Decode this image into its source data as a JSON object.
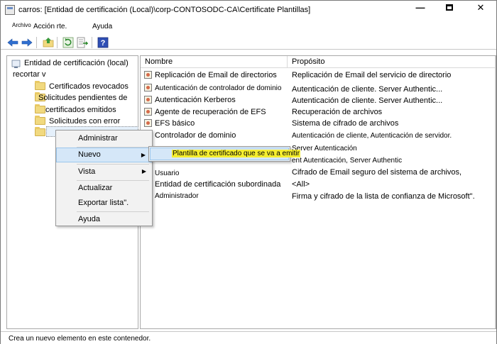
{
  "window": {
    "title": "carros: [Entidad de certificación       (Local)\\corp-CONTOSODC-CA\\Certificate Plantillas]",
    "controls": {
      "minimize": "—",
      "close": "✕"
    }
  },
  "menubar": {
    "items": [
      {
        "label": "Archivo"
      },
      {
        "label": "Acción rte."
      },
      {
        "label": "Ayuda"
      }
    ]
  },
  "toolbar": {
    "icons": [
      "back-arrow-icon",
      "forward-arrow-icon",
      "up-folder-icon",
      "refresh-icon",
      "export-list-icon",
      "help-icon"
    ],
    "help_glyph": "?"
  },
  "tree": {
    "root_line1": "Entidad de certificación (local)",
    "root_line2": "recortar v",
    "items": [
      {
        "label": "Certificados revocados"
      },
      {
        "label": "Solicitudes pendientes de"
      },
      {
        "label": "certificados emitidos"
      },
      {
        "label": "Solicitudes con error"
      }
    ]
  },
  "list": {
    "columns": [
      "Nombre",
      "Propósito"
    ],
    "rows": [
      {
        "name": "Replicación de Email de directorios",
        "purpose": "Replicación de Email del servicio de directorio"
      },
      {
        "name": "Autenticación de controlador de dominio",
        "purpose": "Autenticación de cliente. Server Authentic..."
      },
      {
        "name": "Autenticación Kerberos",
        "purpose": "Autenticación de cliente. Server Authentic..."
      },
      {
        "name": "Agente de recuperación de EFS",
        "purpose": "Recuperación de archivos"
      },
      {
        "name": "EFS básico",
        "purpose": "Sistema de cifrado de archivos"
      },
      {
        "name": "Controlador de dominio",
        "purpose": "Autenticación de cliente, Autenticación de servidor."
      },
      {
        "name": "",
        "purpose": "Server Autenticación"
      },
      {
        "name": "",
        "purpose": "ent Autenticación, Server Authentic"
      },
      {
        "name": "Usuario",
        "purpose": "Cifrado de Email seguro del sistema de archivos,"
      },
      {
        "name": "Entidad de certificación subordinada",
        "purpose": "<All>"
      },
      {
        "name": "Administrador",
        "purpose": "Firma y cifrado de la lista de confianza de Microsoft\"."
      }
    ]
  },
  "context_menu": {
    "items": [
      {
        "label": "Administrar"
      },
      {
        "label": "Nuevo"
      },
      {
        "label": "Vista"
      },
      {
        "label": "Actualizar"
      },
      {
        "label": "Exportar lista\"."
      },
      {
        "label": "Ayuda"
      }
    ],
    "submenu_arrow": "▶"
  },
  "submenu": {
    "label": "Plantilla de certificado que se va a emitir"
  },
  "statusbar": {
    "text": "Crea un nuevo elemento en este contenedor."
  },
  "colors": {
    "highlight_bg": "#d5e7f8",
    "highlight_border": "#9bc6ec",
    "text_highlight": "#f5ee2f",
    "folder": "#f1d97f"
  }
}
